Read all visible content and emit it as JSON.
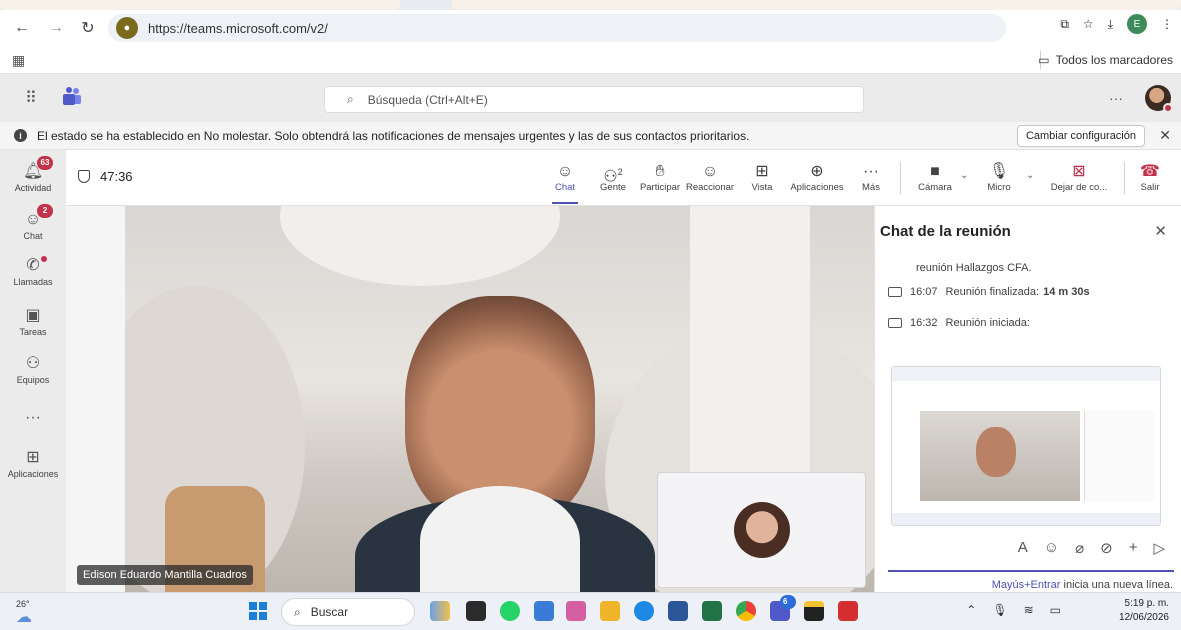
{
  "browser": {
    "url": "https://teams.microsoft.com/v2/",
    "profile_initial": "E",
    "bookmarks_label": "Todos los marcadores"
  },
  "teams": {
    "search_placeholder": "Búsqueda (Ctrl+Alt+E)",
    "more": "···"
  },
  "banner": {
    "message": "El estado se ha establecido en No molestar. Solo obtendrá las notificaciones de mensajes urgentes y las de sus contactos prioritarios.",
    "action": "Cambiar configuración"
  },
  "rail": {
    "items": [
      {
        "label": "Actividad",
        "badge": "63"
      },
      {
        "label": "Chat",
        "badge": "2"
      },
      {
        "label": "Llamadas"
      },
      {
        "label": "Tareas"
      },
      {
        "label": "Equipos"
      },
      {
        "label": "···"
      },
      {
        "label": "Aplicaciones"
      }
    ]
  },
  "meeting": {
    "timer": "47:36",
    "participants_count": "2",
    "buttons": {
      "chat": "Chat",
      "people": "Gente",
      "raise": "Participar",
      "react": "Reaccionar",
      "view": "Vista",
      "apps": "Aplicaciones",
      "more": "Más",
      "camera": "Cámara",
      "mic": "Micro",
      "share": "Dejar de co...",
      "leave": "Salir"
    },
    "speaker_name": "Edison Eduardo Mantilla Cuadros"
  },
  "chat_panel": {
    "title": "Chat de la reunión",
    "line1": "reunión Hallazgos CFA.",
    "line2_time": "16:07",
    "line2_text": "Reunión finalizada:",
    "line2_duration": "14 m 30s",
    "line3_time": "16:32",
    "line3_text": "Reunión iniciada:",
    "hint_key": "Mayús+Entrar",
    "hint_rest": " inicia una nueva línea."
  },
  "taskbar": {
    "weather": "26°",
    "search_label": "Buscar",
    "time": "5:19 p. m.",
    "date": "12/06/2026",
    "teams_badge": "6"
  },
  "colors": {
    "accent": "#4f52b2",
    "alert": "#c4314b",
    "leave": "#c4314b"
  }
}
